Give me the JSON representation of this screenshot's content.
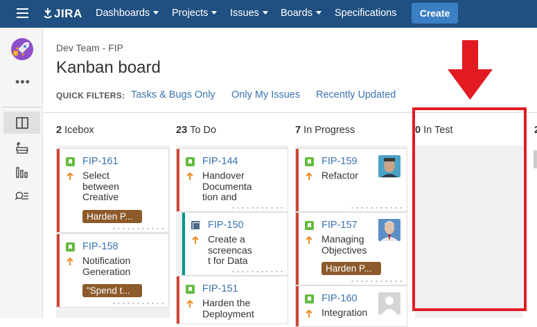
{
  "header": {
    "logo_text": "JIRA",
    "nav": [
      {
        "label": "Dashboards",
        "caret": true
      },
      {
        "label": "Projects",
        "caret": true
      },
      {
        "label": "Issues",
        "caret": true
      },
      {
        "label": "Boards",
        "caret": true
      },
      {
        "label": "Specifications",
        "caret": false
      }
    ],
    "create_label": "Create"
  },
  "page": {
    "breadcrumb": "Dev Team - FIP",
    "title": "Kanban board",
    "quick_filters_label": "QUICK FILTERS:",
    "quick_filters": [
      "Tasks & Bugs Only",
      "Only My Issues",
      "Recently Updated"
    ]
  },
  "columns": [
    {
      "count": "2",
      "name": "Icebox"
    },
    {
      "count": "23",
      "name": "To Do"
    },
    {
      "count": "7",
      "name": "In Progress"
    },
    {
      "count": "0",
      "name": "In Test"
    },
    {
      "count": "2",
      "name": ""
    }
  ],
  "cards": {
    "c161": {
      "key": "FIP-161",
      "summary": [
        "Select",
        "between",
        "Creative"
      ],
      "epic": "Harden P..."
    },
    "c158": {
      "key": "FIP-158",
      "summary": [
        "Notification",
        "Generation"
      ],
      "epic": "\"Spend t..."
    },
    "c144": {
      "key": "FIP-144",
      "summary": [
        "Handover",
        "Documenta",
        "tion and"
      ]
    },
    "c150": {
      "key": "FIP-150",
      "summary": [
        "Create a",
        "screencas",
        "t for Data"
      ]
    },
    "c151": {
      "key": "FIP-151",
      "summary": [
        "Harden the",
        "Deployment"
      ]
    },
    "c159": {
      "key": "FIP-159",
      "summary": [
        "Refactor"
      ]
    },
    "c157": {
      "key": "FIP-157",
      "summary": [
        "Managing",
        "Objectives"
      ],
      "epic": "Harden P..."
    },
    "c160": {
      "key": "FIP-160",
      "summary": [
        "Integration"
      ]
    }
  },
  "colors": {
    "header_bg": "#205081",
    "create_bg": "#3b7fc4",
    "link": "#3b73af",
    "priority_bar": "#d04437",
    "task_bar": "#009688",
    "epic_bg": "#8c5a2b",
    "highlight": "#e21b23"
  },
  "icons": [
    "menu-icon",
    "jira-logo-icon",
    "project-avatar-icon",
    "more-icon",
    "board-icon",
    "backlog-icon",
    "reports-icon",
    "search-issues-icon",
    "story-icon",
    "task-icon",
    "priority-high-icon",
    "user-avatar-icon",
    "red-arrow-icon"
  ]
}
